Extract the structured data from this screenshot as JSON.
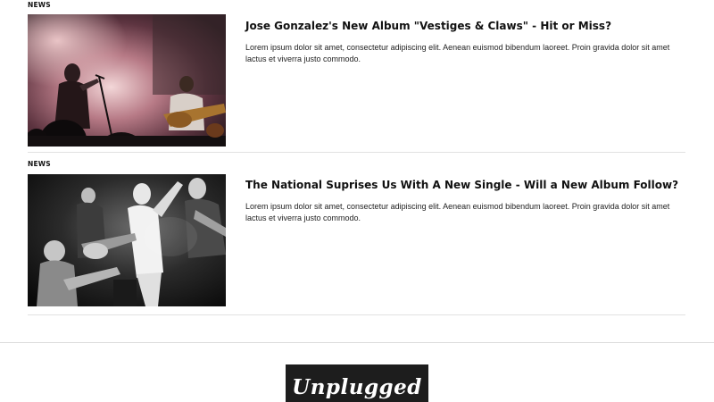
{
  "articles": [
    {
      "category": "NEWS",
      "title": "Jose Gonzalez's New Album \"Vestiges & Claws\" - Hit or Miss?",
      "excerpt": "Lorem ipsum dolor sit amet, consectetur adipiscing elit. Aenean euismod bibendum laoreet. Proin gravida dolor sit amet lactus et viverra justo commodo.",
      "image": "concert-photo-color"
    },
    {
      "category": "NEWS",
      "title": "The National Suprises Us With A New Single - Will a New Album Follow?",
      "excerpt": "Lorem ipsum dolor sit amet, consectetur adipiscing elit. Aenean euismod bibendum laoreet. Proin gravida dolor sit amet lactus et viverra justo commodo.",
      "image": "concert-photo-bw"
    }
  ],
  "footer": {
    "logo_text": "Unplugged"
  },
  "colors": {
    "logo_bg": "#1d1d1d",
    "divider": "#e2e2e2"
  }
}
